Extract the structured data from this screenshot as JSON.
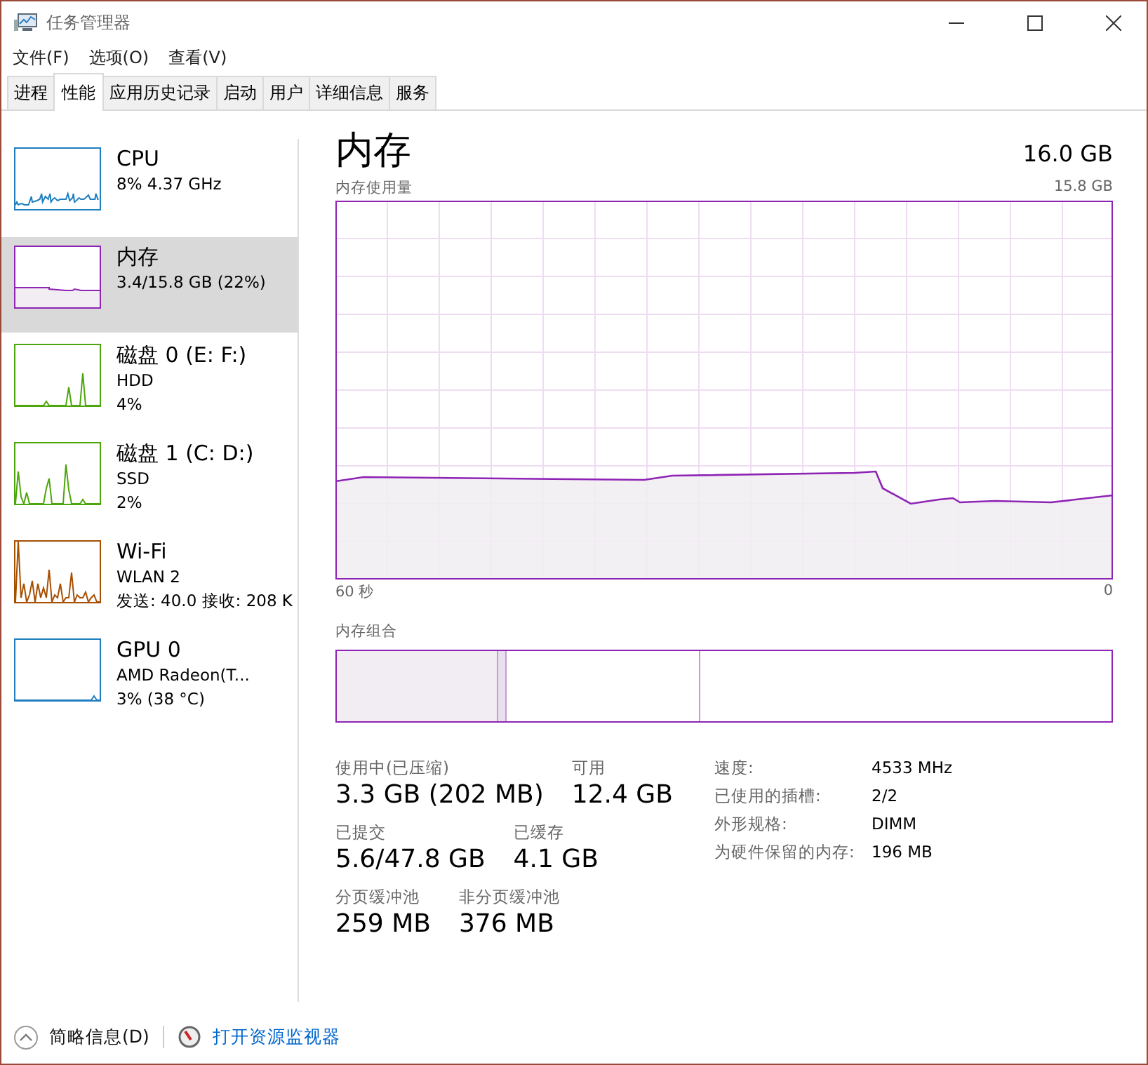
{
  "window": {
    "title": "任务管理器"
  },
  "menu": [
    "文件(F)",
    "选项(O)",
    "查看(V)"
  ],
  "tabs": [
    {
      "label": "进程",
      "selected": false
    },
    {
      "label": "性能",
      "selected": true
    },
    {
      "label": "应用历史记录",
      "selected": false
    },
    {
      "label": "启动",
      "selected": false
    },
    {
      "label": "用户",
      "selected": false
    },
    {
      "label": "详细信息",
      "selected": false
    },
    {
      "label": "服务",
      "selected": false
    }
  ],
  "sidebar": {
    "items": [
      {
        "title": "CPU",
        "lines": [
          "8% 4.37 GHz"
        ],
        "color": "#1f7ebf",
        "selected": false
      },
      {
        "title": "内存",
        "lines": [
          "3.4/15.8 GB (22%)"
        ],
        "color": "#8e24b4",
        "selected": true
      },
      {
        "title": "磁盘 0 (E: F:)",
        "lines": [
          "HDD",
          "4%"
        ],
        "color": "#4da60c",
        "selected": false
      },
      {
        "title": "磁盘 1 (C: D:)",
        "lines": [
          "SSD",
          "2%"
        ],
        "color": "#4da60c",
        "selected": false
      },
      {
        "title": "Wi-Fi",
        "lines": [
          "WLAN 2",
          "发送: 40.0 接收: 208 K"
        ],
        "color": "#a74f01",
        "selected": false
      },
      {
        "title": "GPU 0",
        "lines": [
          "AMD Radeon(T...",
          "3% (38 °C)"
        ],
        "color": "#1f7ebf",
        "selected": false
      }
    ]
  },
  "detail": {
    "title": "内存",
    "total": "16.0 GB",
    "graph_label": "内存使用量",
    "graph_max": "15.8 GB",
    "time_start": "60 秒",
    "time_end": "0",
    "composition_label": "内存组合",
    "stats": [
      [
        {
          "label": "使用中(已压缩)",
          "value": "3.3 GB (202 MB)"
        },
        {
          "label": "可用",
          "value": "12.4 GB"
        }
      ],
      [
        {
          "label": "已提交",
          "value": "5.6/47.8 GB"
        },
        {
          "label": "已缓存",
          "value": "4.1 GB"
        }
      ],
      [
        {
          "label": "分页缓冲池",
          "value": "259 MB"
        },
        {
          "label": "非分页缓冲池",
          "value": "376 MB"
        }
      ]
    ],
    "specs": [
      {
        "label": "速度:",
        "value": "4533 MHz"
      },
      {
        "label": "已使用的插槽:",
        "value": "2/2"
      },
      {
        "label": "外形规格:",
        "value": "DIMM"
      },
      {
        "label": "为硬件保留的内存:",
        "value": "196 MB"
      }
    ]
  },
  "footer": {
    "fewer_details": "简略信息(D)",
    "open_monitor": "打开资源监视器"
  }
}
